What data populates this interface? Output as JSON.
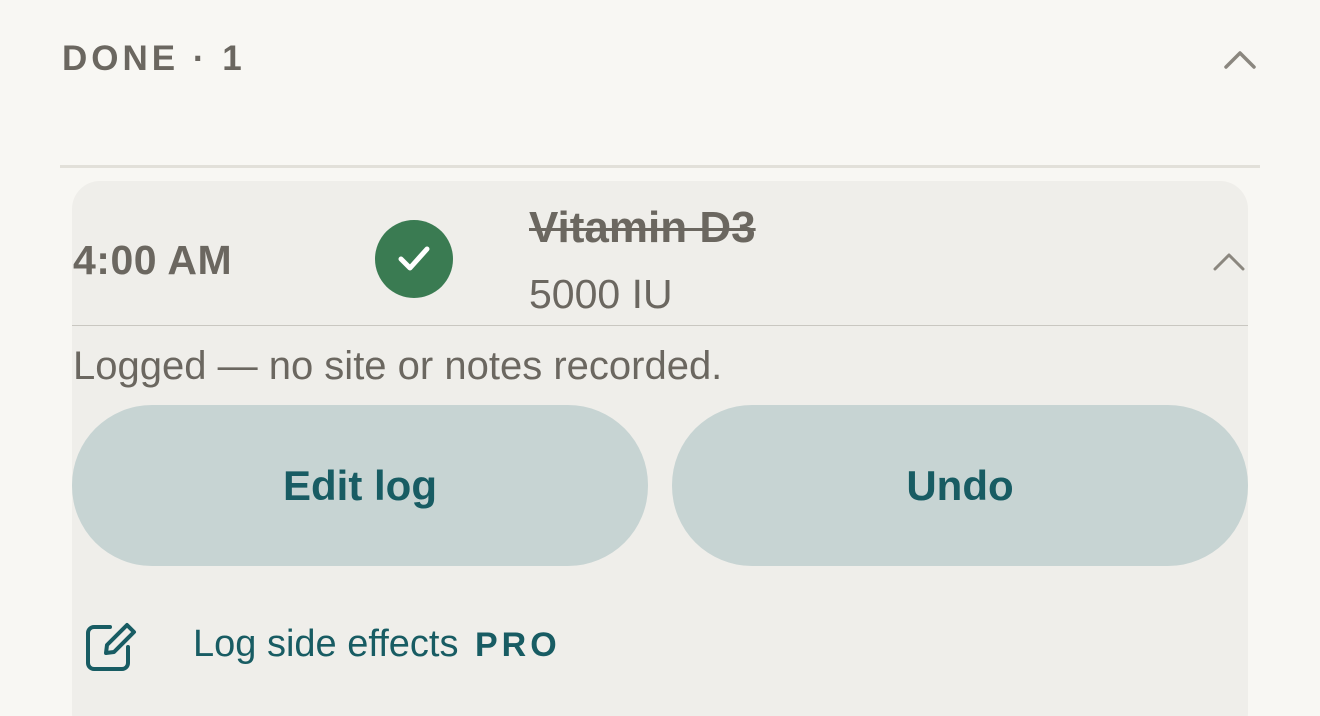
{
  "section": {
    "title": "DONE · 1",
    "toggle_icon": "chevron-up-icon"
  },
  "dose": {
    "time": "4:00 AM",
    "status_icon": "checkmark-icon",
    "status_color": "#3a7b52",
    "medication_name": "Vitamin D3",
    "medication_dose": "5000 IU",
    "toggle_icon": "chevron-up-icon",
    "log_note": "Logged — no site or notes recorded.",
    "edit_log_label": "Edit log",
    "undo_label": "Undo",
    "side_effects_icon": "edit-note-icon",
    "side_effects_label": "Log side effects",
    "pro_badge": "PRO"
  },
  "colors": {
    "accent": "#185c63",
    "button_background": "#c7d4d3",
    "card_background": "#efeeea",
    "page_background": "#f8f7f3",
    "muted_text": "#6b6760"
  }
}
